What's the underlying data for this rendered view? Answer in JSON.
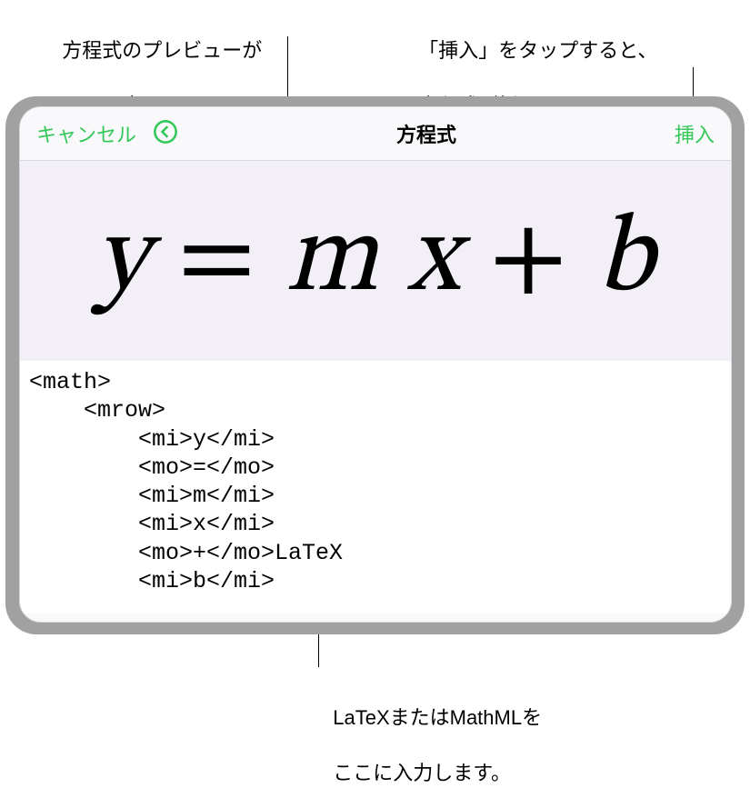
{
  "annotations": {
    "preview_hint_l1": "方程式のプレビューが",
    "preview_hint_l2": "ここに表示されます。",
    "insert_hint_l1": "「挿入」をタップすると、",
    "insert_hint_l2": "方程式が挿入されます。",
    "code_hint_l1": "LaTeXまたはMathMLを",
    "code_hint_l2": "ここに入力します。"
  },
  "topbar": {
    "cancel": "キャンセル",
    "title": "方程式",
    "insert": "挿入"
  },
  "equation": {
    "y": "y",
    "eq": "=",
    "m": "m",
    "x": "x",
    "plus": "+",
    "b": "b"
  },
  "code": {
    "l1": "<math>",
    "l2": "    <mrow>",
    "l3": "        <mi>y</mi>",
    "l4": "        <mo>=</mo>",
    "l5": "        <mi>m</mi>",
    "l6": "        <mi>x</mi>",
    "l7": "        <mo>+</mo>LaTeX",
    "l8": "        <mi>b</mi>"
  }
}
